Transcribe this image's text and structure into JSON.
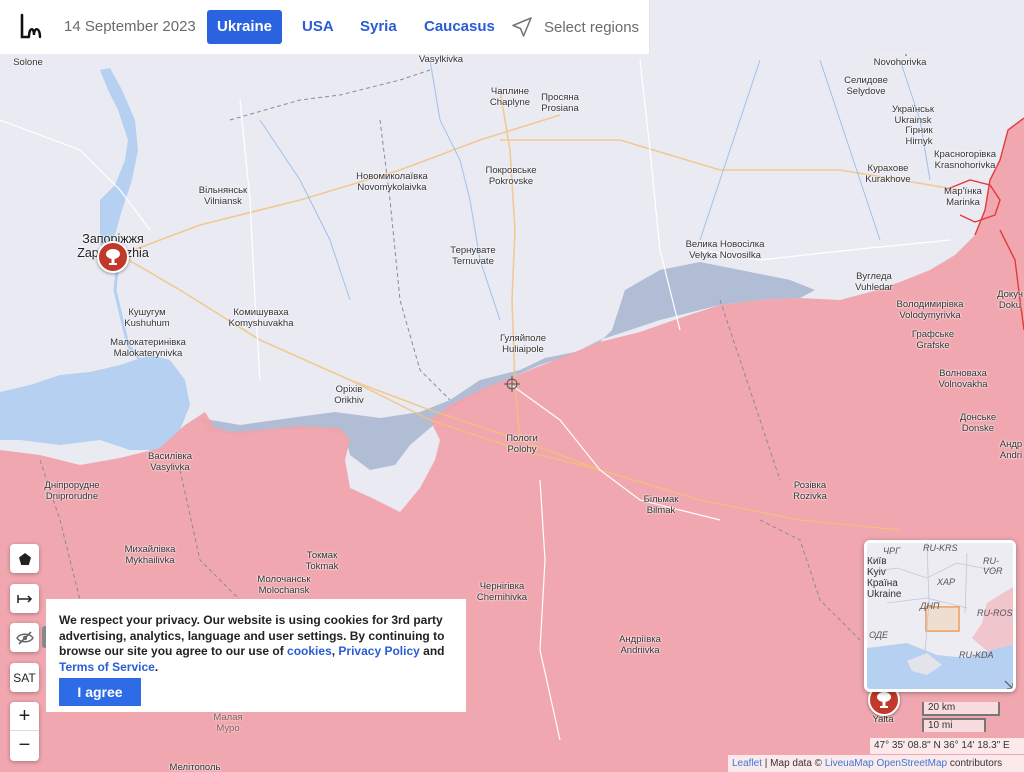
{
  "header": {
    "date": "14 September 2023",
    "tabs": [
      {
        "label": "Ukraine",
        "active": true
      },
      {
        "label": "USA",
        "active": false
      },
      {
        "label": "Syria",
        "active": false
      },
      {
        "label": "Caucasus",
        "active": false
      }
    ],
    "select_regions": "Select regions",
    "logo_icon": "liveuamap-logo-icon"
  },
  "map": {
    "colors": {
      "occupied": "#f0a3ab",
      "contested": "#a6b5cf",
      "land": "#eaeaf3",
      "water": "#b5d0f0"
    },
    "places": [
      {
        "text": "Solone"
      },
      {
        "text": "Vasylkivka"
      },
      {
        "text": "Запоріжжя\nZaporizhzhia"
      },
      {
        "text": "Вільнянськ\nVilniansk"
      },
      {
        "text": "Новомиколаївка\nNovomykolaivka"
      },
      {
        "text": "Покровське\nPokrovske"
      },
      {
        "text": "Чаплине\nChaplyne"
      },
      {
        "text": "Просяна\nProsiana"
      },
      {
        "text": "Тернувате\nTernuvate"
      },
      {
        "text": "Велика Новосілка\nVelyka Novosilka"
      },
      {
        "text": "Вугледа\nVuhledar"
      },
      {
        "text": "Кушугум\nKushuhum"
      },
      {
        "text": "Комишуваха\nKomyshuvakha"
      },
      {
        "text": "Малокатеринівка\nMalokaterynivka"
      },
      {
        "text": "Гуляйполе\nHuliaipole"
      },
      {
        "text": "Оріхів\nOrikhiv"
      },
      {
        "text": "Пологи\nPolohy"
      },
      {
        "text": "Василівка\nVasylivka"
      },
      {
        "text": "Дніпрорудне\nDniprorudne"
      },
      {
        "text": "Більмак\nBilmak"
      },
      {
        "text": "Розівка\nRozivka"
      },
      {
        "text": "Михайлівка\nMykhailivka"
      },
      {
        "text": "Токмак\nTokmak"
      },
      {
        "text": "Молочанськ\nMolochansk"
      },
      {
        "text": "Чернігівка\nChernihivka"
      },
      {
        "text": "Андріївка\nAndriivka"
      },
      {
        "text": "Новохорівка\nNovohorivka"
      },
      {
        "text": "Селидове\nSelydove"
      },
      {
        "text": "Українськ\nUkrainsk"
      },
      {
        "text": "Гірник\nHirnyk"
      },
      {
        "text": "Курахове\nKurakhove"
      },
      {
        "text": "Красногорівка\nKrasnohorivka"
      },
      {
        "text": "Мар'їнка\nMarinka"
      },
      {
        "text": "Володимирівка\nVolodymyrivka"
      },
      {
        "text": "Графське\nGrafske"
      },
      {
        "text": "Волновахa\nVolnovakha"
      },
      {
        "text": "Донське\nDonske"
      },
      {
        "text": "Андр\nAndri"
      },
      {
        "text": "Докуч\nDoku"
      },
      {
        "text": "Yalta"
      },
      {
        "text": "Мелітополь"
      },
      {
        "text": "Малая\nМуро"
      }
    ],
    "controls": {
      "polygon_icon": "pentagon-icon",
      "measure_icon": "ruler-icon",
      "hide_icon": "eye-off-icon",
      "show_label": "show",
      "sat_label": "SAT",
      "zoom_in": "+",
      "zoom_out": "−"
    }
  },
  "cookie": {
    "text_before": "We respect your privacy. Our website is using cookies for 3rd party advertising, analytics, language and user settings. By continuing to browse our site you agree to our use of ",
    "link_cookies": "cookies",
    "sep1": ", ",
    "link_privacy": "Privacy Policy",
    "sep2": " and ",
    "link_terms": "Terms of Service",
    "end": ".",
    "button": "I agree"
  },
  "minimap": {
    "labels": [
      {
        "text": "ЧРГ"
      },
      {
        "text": "RU-KRS"
      },
      {
        "text": "Київ\nKyiv\nКраїна\nUkraine"
      },
      {
        "text": "RU-VOR"
      },
      {
        "text": "ХАР"
      },
      {
        "text": "ДНП"
      },
      {
        "text": "RU-ROS"
      },
      {
        "text": "ОДЕ"
      },
      {
        "text": "RU-KDA"
      }
    ]
  },
  "scale": {
    "km": "20 km",
    "mi": "10 mi"
  },
  "coords": "47° 35' 08.8\" N 36° 14' 18.3\" E",
  "attribution": {
    "leaflet": "Leaflet",
    "sep": " | Map data © ",
    "liveua": "LiveuaMap",
    "osm": "OpenStreetMap",
    "tail": " contributors"
  }
}
